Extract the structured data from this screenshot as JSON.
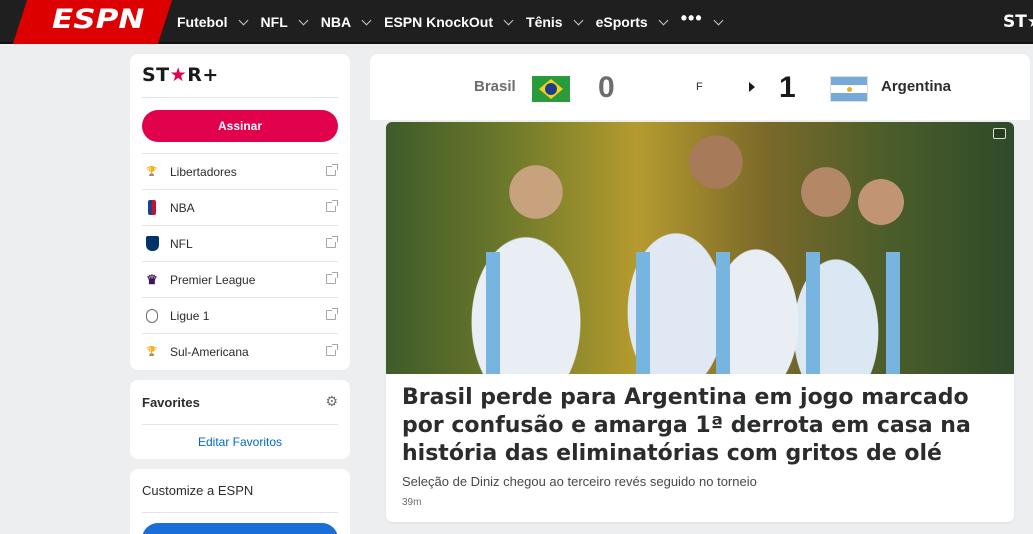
{
  "nav": {
    "logo": "ESPN",
    "items": [
      "Futebol",
      "NFL",
      "NBA",
      "ESPN KnockOut",
      "Tênis",
      "eSports"
    ],
    "more": "•••",
    "starplus": "ST★"
  },
  "starplus_card": {
    "logo_a": "ST",
    "logo_star": "★",
    "logo_b": "R+",
    "subscribe": "Assinar",
    "leagues": [
      {
        "label": "Libertadores",
        "icon": "trophy-icon"
      },
      {
        "label": "NBA",
        "icon": "nba-logo-icon"
      },
      {
        "label": "NFL",
        "icon": "nfl-shield-icon"
      },
      {
        "label": "Premier League",
        "icon": "premier-league-icon"
      },
      {
        "label": "Ligue 1",
        "icon": "ligue1-icon"
      },
      {
        "label": "Sul-Americana",
        "icon": "trophy-icon"
      }
    ]
  },
  "favorites": {
    "title": "Favorites",
    "edit": "Editar Favoritos"
  },
  "customize": {
    "title": "Customize a ESPN"
  },
  "scoreboard": {
    "home_team": "Brasil",
    "home_score": "0",
    "status": "F",
    "away_score": "1",
    "away_team": "Argentina"
  },
  "article": {
    "headline": "Brasil perde para Argentina em jogo marcado por confusão e amarga 1ª derrota em casa na história das eliminatórias com gritos de olé",
    "subtext": "Seleção de Diniz chegou ao terceiro revés seguido no torneio",
    "timestamp": "39m"
  },
  "colors": {
    "espn_red": "#dd0000",
    "starplus_pink": "#e2014c",
    "link_blue": "#0066cc"
  }
}
